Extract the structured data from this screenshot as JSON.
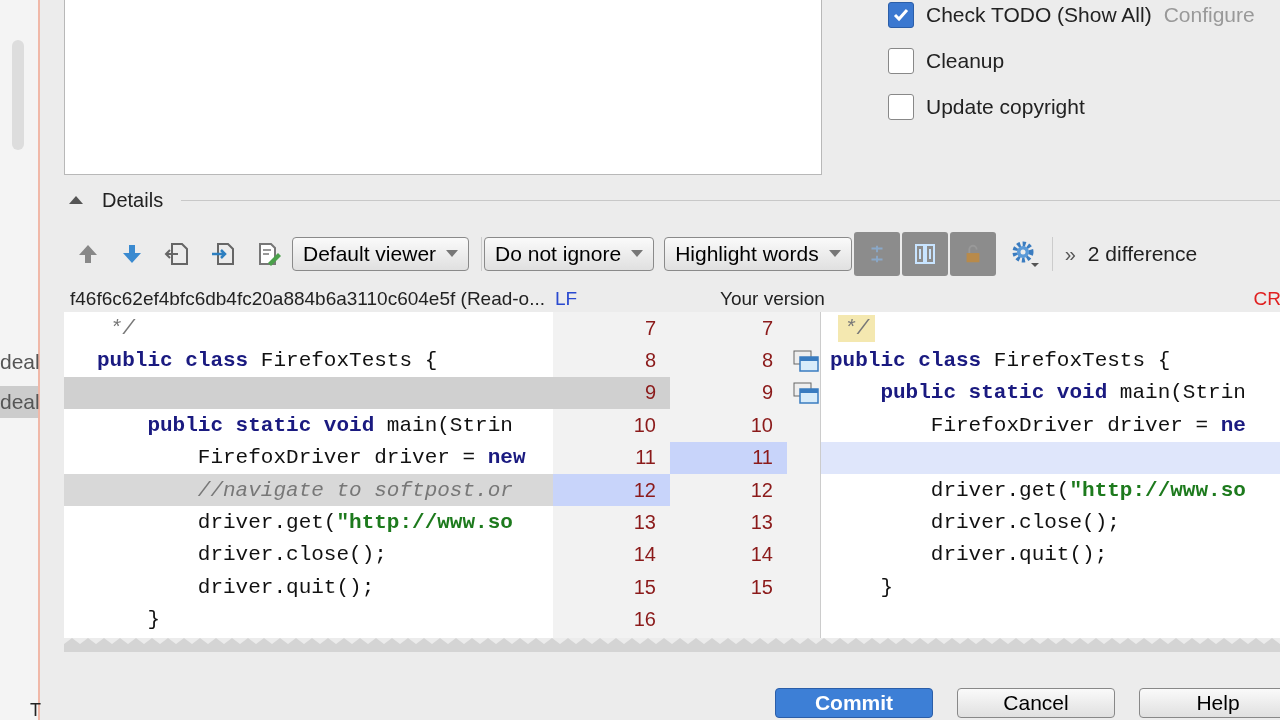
{
  "sidebar": {
    "items": [
      {
        "label": "deal",
        "selected": false
      },
      {
        "label": "deal",
        "selected": true
      }
    ],
    "footer": "T"
  },
  "options": [
    {
      "label": "Check TODO (Show All)",
      "checked": true,
      "link": "Configure"
    },
    {
      "label": "Cleanup",
      "checked": false
    },
    {
      "label": "Update copyright",
      "checked": false
    }
  ],
  "details": {
    "title": "Details",
    "expanded": true
  },
  "toolbar": {
    "viewers": [
      "Default viewer",
      "Do not ignore",
      "Highlight words"
    ],
    "more": "»",
    "summary": "2 difference"
  },
  "header": {
    "left_file": "f46f6c62ef4bfc6db4fc20a884b6a3110c604e5f (Read-o...",
    "left_sep": "LF",
    "right_file": "Your version",
    "right_sep": "CR"
  },
  "diff": {
    "left": [
      {
        "num": "7",
        "kind": "same",
        "code": [
          {
            "kind": "comment",
            "text": " */"
          }
        ]
      },
      {
        "num": "8",
        "kind": "same",
        "code": [
          {
            "kind": "keyword",
            "text": "public class "
          },
          {
            "kind": "plain",
            "text": "FirefoxTests {"
          }
        ]
      },
      {
        "num": "9",
        "kind": "deleted"
      },
      {
        "num": "10",
        "kind": "same",
        "code": [
          {
            "kind": "keyword",
            "text": "    public static void "
          },
          {
            "kind": "plain",
            "text": "main(Strin"
          }
        ]
      },
      {
        "num": "11",
        "kind": "same",
        "code": [
          {
            "kind": "plain",
            "text": "        FirefoxDriver driver = "
          },
          {
            "kind": "keyword",
            "text": "new"
          }
        ]
      },
      {
        "num": "12",
        "kind": "changed",
        "code": [
          {
            "kind": "comment",
            "text": "        //navigate to softpost.or"
          }
        ]
      },
      {
        "num": "13",
        "kind": "same",
        "code": [
          {
            "kind": "plain",
            "text": "        driver.get("
          },
          {
            "kind": "string",
            "text": "\"http://www.so"
          }
        ]
      },
      {
        "num": "14",
        "kind": "same",
        "code": [
          {
            "kind": "plain",
            "text": "        driver.close();"
          }
        ]
      },
      {
        "num": "15",
        "kind": "same",
        "code": [
          {
            "kind": "plain",
            "text": "        driver.quit();"
          }
        ]
      },
      {
        "num": "16",
        "kind": "same",
        "code": [
          {
            "kind": "plain",
            "text": "    }"
          }
        ]
      }
    ],
    "right": [
      {
        "num": "7",
        "kind": "same",
        "code": [
          {
            "kind": "highlight",
            "text": "*/"
          }
        ]
      },
      {
        "num": "8",
        "kind": "same",
        "marker": true,
        "code": [
          {
            "kind": "keyword",
            "text": "public class "
          },
          {
            "kind": "plain",
            "text": "FirefoxTests {"
          }
        ]
      },
      {
        "num": "9",
        "kind": "same",
        "marker": true,
        "code": [
          {
            "kind": "keyword",
            "text": "    public static void "
          },
          {
            "kind": "plain",
            "text": "main(Strin"
          }
        ]
      },
      {
        "num": "10",
        "kind": "same",
        "code": [
          {
            "kind": "plain",
            "text": "        FirefoxDriver driver = "
          },
          {
            "kind": "keyword",
            "text": "ne"
          }
        ]
      },
      {
        "num": "11",
        "kind": "changed"
      },
      {
        "num": "12",
        "kind": "same",
        "code": [
          {
            "kind": "plain",
            "text": "        driver.get("
          },
          {
            "kind": "string",
            "text": "\"http://www.so"
          }
        ]
      },
      {
        "num": "13",
        "kind": "same",
        "code": [
          {
            "kind": "plain",
            "text": "        driver.close();"
          }
        ]
      },
      {
        "num": "14",
        "kind": "same",
        "code": [
          {
            "kind": "plain",
            "text": "        driver.quit();"
          }
        ]
      },
      {
        "num": "15",
        "kind": "same",
        "code": [
          {
            "kind": "plain",
            "text": "    }"
          }
        ]
      }
    ]
  },
  "buttons": [
    {
      "label": "Commit",
      "kind": "primary"
    },
    {
      "label": "Cancel",
      "kind": "normal"
    },
    {
      "label": "Help",
      "kind": "normal"
    }
  ]
}
